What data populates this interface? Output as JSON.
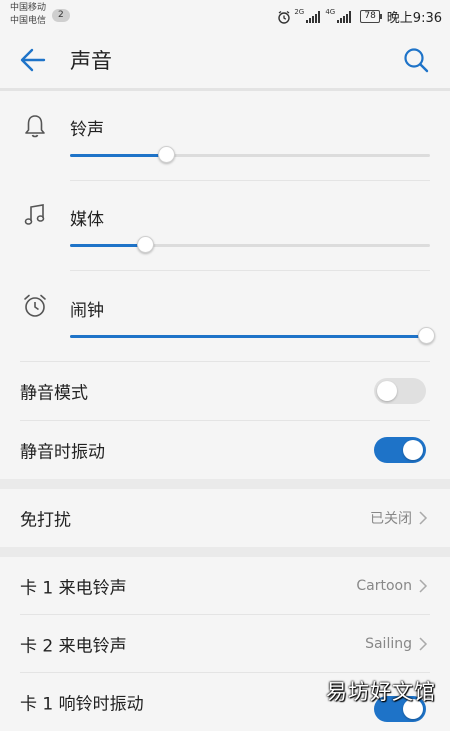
{
  "status_bar": {
    "carrier1": "中国移动",
    "carrier2": "中国电信",
    "sim_badge": "2",
    "signal1_tag": "2G",
    "signal2_tag": "4G",
    "battery": "78",
    "time": "晚上9:36"
  },
  "header": {
    "title": "声音",
    "back_icon": "arrow-left-icon",
    "search_icon": "search-icon",
    "accent_color": "#1e73c8"
  },
  "volumes": [
    {
      "label": "铃声",
      "icon": "bell-icon",
      "level": 0.27
    },
    {
      "label": "媒体",
      "icon": "music-note-icon",
      "level": 0.21
    },
    {
      "label": "闹钟",
      "icon": "alarm-clock-icon",
      "level": 1.0
    }
  ],
  "toggles": [
    {
      "label": "静音模式",
      "on": false
    },
    {
      "label": "静音时振动",
      "on": true
    }
  ],
  "dnd": {
    "label": "免打扰",
    "value": "已关闭"
  },
  "ringtones": [
    {
      "label": "卡 1 来电铃声",
      "value": "Cartoon"
    },
    {
      "label": "卡 2 来电铃声",
      "value": "Sailing"
    }
  ],
  "vibrate_ring": {
    "label": "卡 1 响铃时振动",
    "on": true
  },
  "watermark": "易坊好文馆"
}
